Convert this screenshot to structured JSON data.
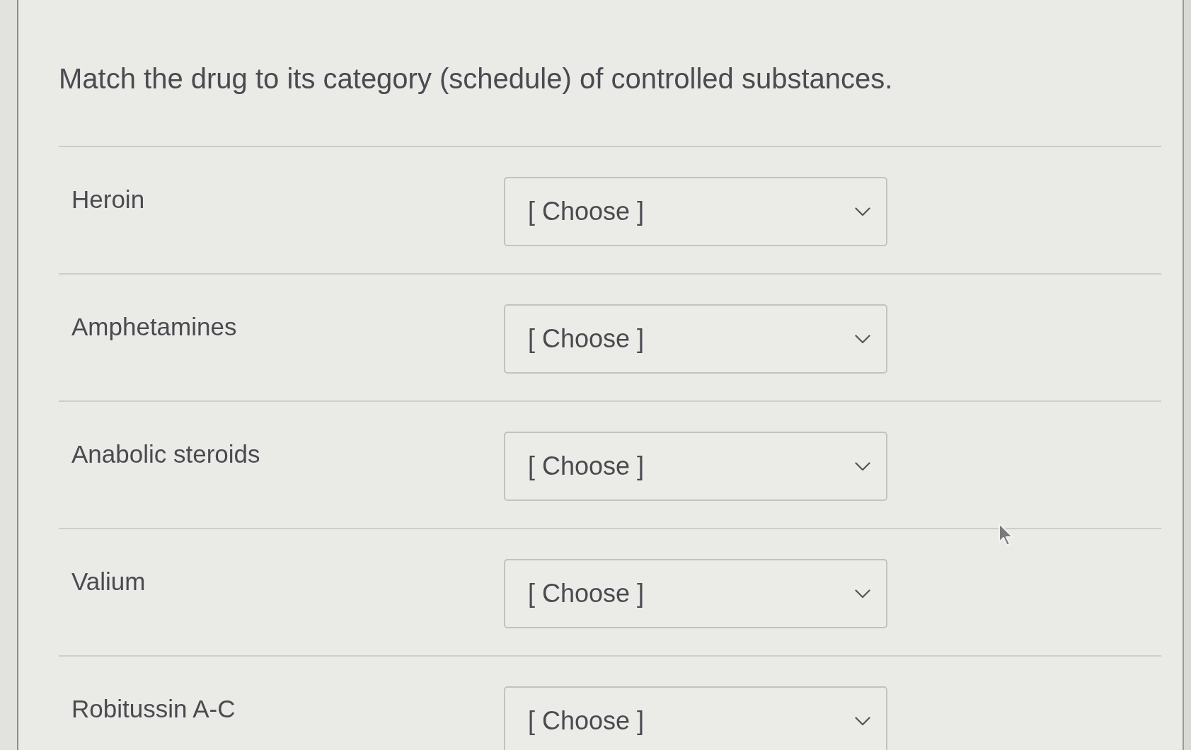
{
  "question": {
    "prompt": "Match the drug to its category (schedule) of controlled substances."
  },
  "items": [
    {
      "label": "Heroin",
      "select": {
        "placeholder": "[ Choose ]"
      }
    },
    {
      "label": "Amphetamines",
      "select": {
        "placeholder": "[ Choose ]"
      }
    },
    {
      "label": "Anabolic steroids",
      "select": {
        "placeholder": "[ Choose ]"
      }
    },
    {
      "label": "Valium",
      "select": {
        "placeholder": "[ Choose ]"
      }
    },
    {
      "label": "Robitussin A-C",
      "select": {
        "placeholder": "[ Choose ]"
      }
    }
  ]
}
